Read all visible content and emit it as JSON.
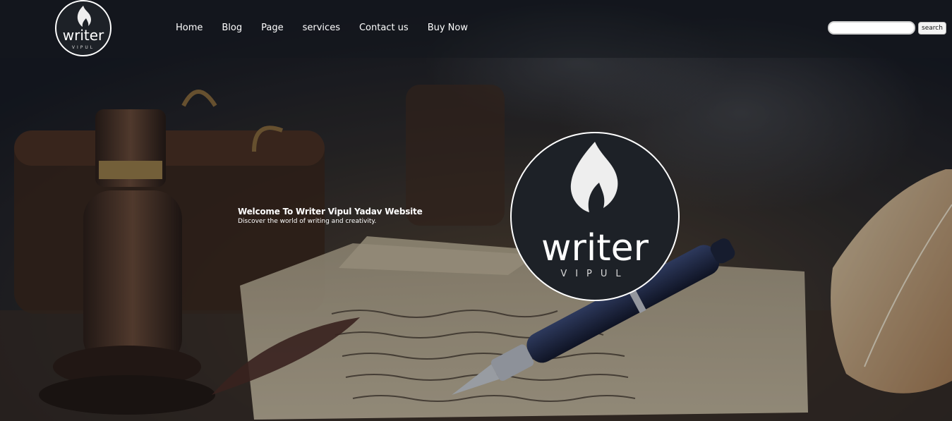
{
  "header": {
    "logo": {
      "word": "writer",
      "tagline": "VIPUL"
    },
    "nav": [
      {
        "label": "Home"
      },
      {
        "label": "Blog"
      },
      {
        "label": "Page"
      },
      {
        "label": "services"
      },
      {
        "label": "Contact us"
      },
      {
        "label": "Buy Now"
      }
    ],
    "search": {
      "value": "",
      "button_label": "search"
    }
  },
  "hero": {
    "title": "Welcome To Writer Vipul Yadav Website",
    "subtitle": "Discover the world of writing and creativity.",
    "logo": {
      "word": "writer",
      "tagline": "VIPUL"
    }
  },
  "colors": {
    "header_bg": "#14171e",
    "logo_bg": "#1d2127",
    "text": "#ffffff"
  },
  "icons": [
    "flame-icon"
  ]
}
